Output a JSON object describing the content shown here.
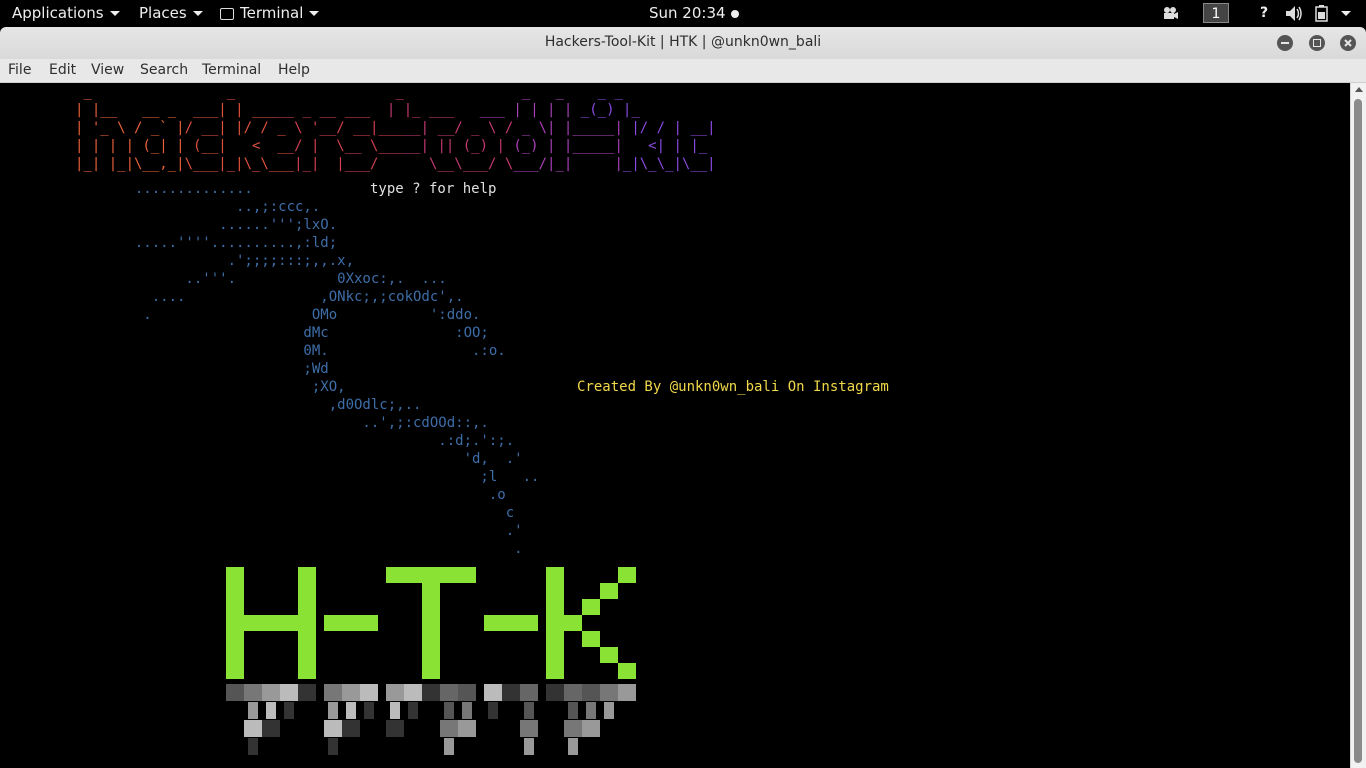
{
  "top_panel": {
    "applications": "Applications",
    "places": "Places",
    "terminal": "Terminal",
    "clock": "Sun 20:34",
    "workspace": "1",
    "help_icon": "?"
  },
  "window": {
    "title": "Hackers-Tool-Kit | HTK | @unkn0wn_bali"
  },
  "menu": {
    "file": "File",
    "edit": "Edit",
    "view": "View",
    "search": "Search",
    "terminal": "Terminal",
    "help": "Help"
  },
  "terminal": {
    "banner_lines": [
      " _                _                   _              _   _    _ _   ",
      "| |__   __ _  ___| | _____ _ __ ___  | |_ ___   ___ | | | | _(_) |_ ",
      "| '_ \\ / _` |/ __| |/ / _ \\ '__/ __|_____| __/ _ \\ / _ \\| |_____| |/ / | __|",
      "| | | | (_| | (__|   <  __/ |  \\__ \\_____| || (_) | (_) | |_____|   <| | |_ ",
      "|_| |_|\\__,_|\\___|_|\\_\\___|_|  |___/      \\__\\___/ \\___/|_|     |_|\\_\\_|\\__|"
    ],
    "banner_colors": [
      "#e8603a",
      "#e0513d",
      "#d2404f",
      "#c43a72",
      "#a940b8",
      "#8a4ae0"
    ],
    "owl_lines": [
      "                ..............",
      "                            ..,;:ccc,.",
      "                          ......''';lxO.",
      "                .....''''..........,:ld;",
      "                           .';;;;:::;,,.x,",
      "                      ..'''.            0Xxoc:,.  ...",
      "                  ....                ,ONkc;,;cokOdc',.",
      "                 .                   OMo           ':ddo.",
      "                                    dMc               :OO;",
      "                                    0M.                 .:o.",
      "                                    ;Wd",
      "                                     ;XO,",
      "                                       ,d0Odlc;,..",
      "                                           ..',;:cdOOd::,.",
      "                                                    .:d;.':;.",
      "                                                       'd,  .'",
      "                                                         ;l   ..",
      "                                                          .o",
      "                                                            c",
      "                                                            .'",
      "                                                             ."
    ],
    "help_text": "type ? for help",
    "credit_text": "Created By @unkn0wn_bali On Instagram",
    "logo_text": "H-T-K",
    "logo_color": "#8ae234"
  }
}
